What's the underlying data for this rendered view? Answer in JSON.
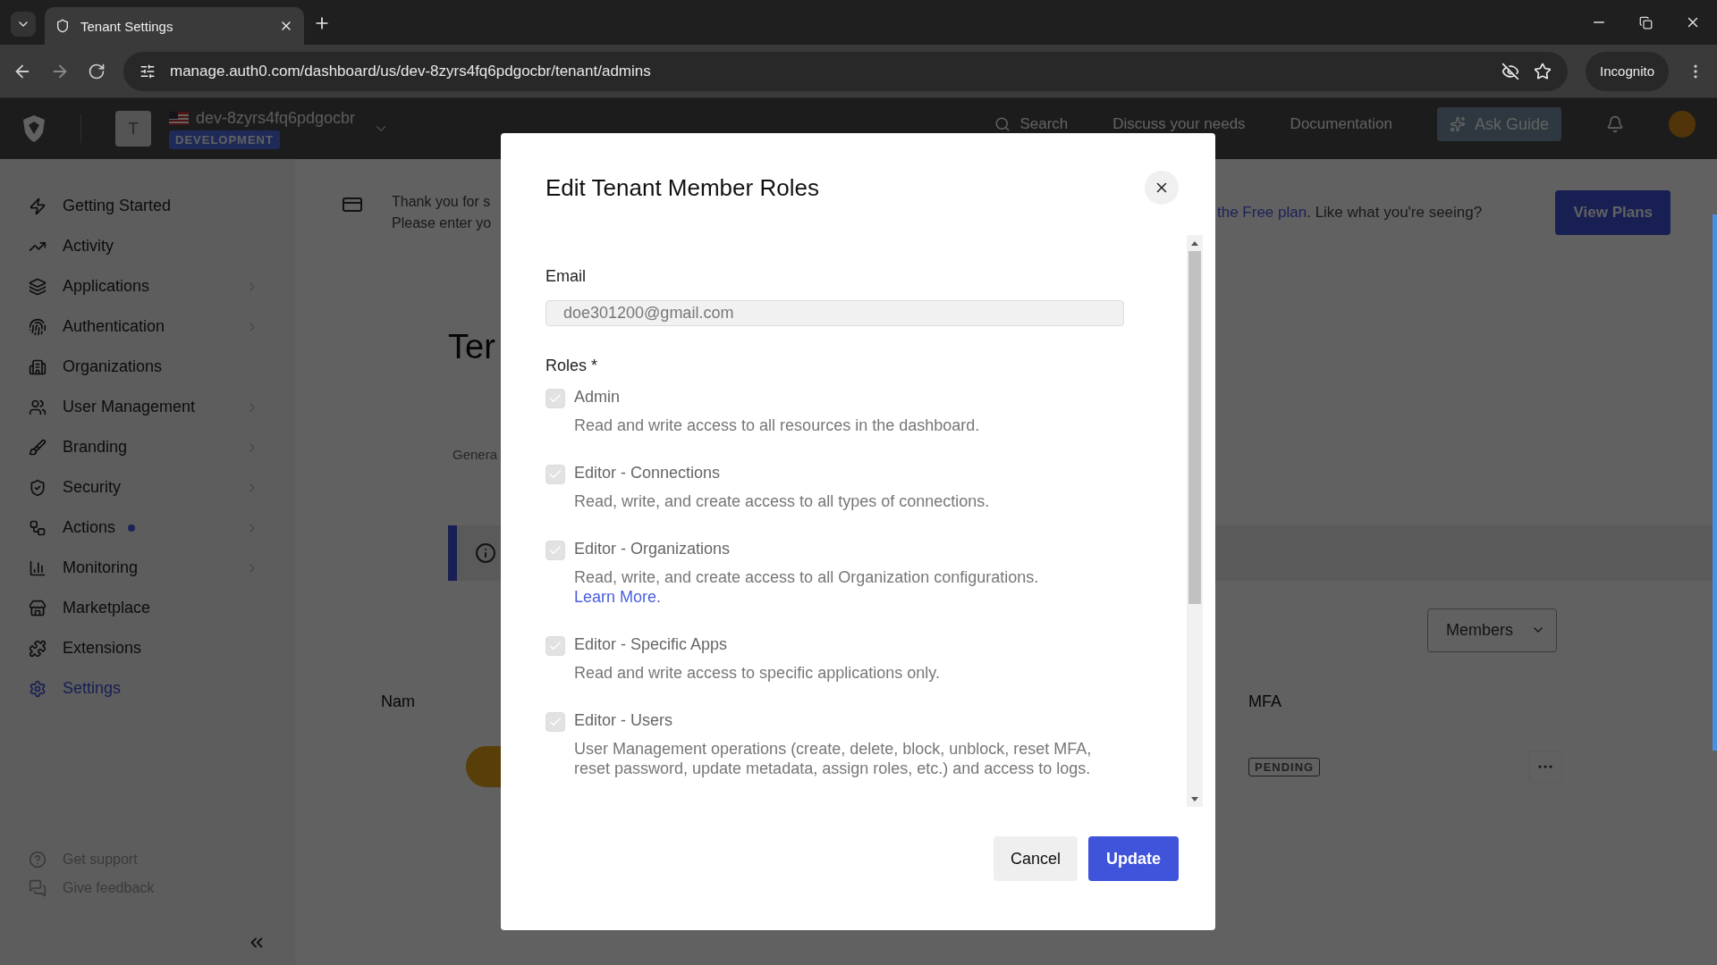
{
  "browser": {
    "tab_title": "Tenant Settings",
    "url": "manage.auth0.com/dashboard/us/dev-8zyrs4fq6pdgocbr/tenant/admins",
    "profile": "Incognito"
  },
  "header": {
    "tenant_initial": "T",
    "tenant_name": "dev-8zyrs4fq6pdgocbr",
    "environment": "DEVELOPMENT",
    "search": "Search",
    "links": [
      "Discuss your needs",
      "Documentation"
    ],
    "ask_guide": "Ask Guide"
  },
  "sidebar": {
    "items": [
      {
        "label": "Getting Started",
        "expandable": false,
        "badge": false,
        "selected": false
      },
      {
        "label": "Activity",
        "expandable": false,
        "badge": false,
        "selected": false
      },
      {
        "label": "Applications",
        "expandable": true,
        "badge": false,
        "selected": false
      },
      {
        "label": "Authentication",
        "expandable": true,
        "badge": false,
        "selected": false
      },
      {
        "label": "Organizations",
        "expandable": false,
        "badge": false,
        "selected": false
      },
      {
        "label": "User Management",
        "expandable": true,
        "badge": false,
        "selected": false
      },
      {
        "label": "Branding",
        "expandable": true,
        "badge": false,
        "selected": false
      },
      {
        "label": "Security",
        "expandable": true,
        "badge": false,
        "selected": false
      },
      {
        "label": "Actions",
        "expandable": true,
        "badge": true,
        "selected": false
      },
      {
        "label": "Monitoring",
        "expandable": true,
        "badge": false,
        "selected": false
      },
      {
        "label": "Marketplace",
        "expandable": false,
        "badge": false,
        "selected": false
      },
      {
        "label": "Extensions",
        "expandable": false,
        "badge": false,
        "selected": false
      },
      {
        "label": "Settings",
        "expandable": false,
        "badge": false,
        "selected": true
      }
    ],
    "footer": [
      "Get support",
      "Give feedback"
    ]
  },
  "page": {
    "banner_left": [
      "Thank you for s",
      "Please enter yo"
    ],
    "banner_link": "the Free plan",
    "banner_right": ". Like what you're seeing?",
    "view_plans": "View Plans",
    "heading": "Ter",
    "tab": "Genera",
    "filter": "Members",
    "columns": [
      "Nam",
      "MFA"
    ],
    "row_status": "PENDING"
  },
  "modal": {
    "title": "Edit Tenant Member Roles",
    "email_label": "Email",
    "email": "doe301200@gmail.com",
    "roles_label": "Roles *",
    "roles": [
      {
        "name": "Admin",
        "description": "Read and write access to all resources in the dashboard.",
        "checked": true,
        "disabled": true
      },
      {
        "name": "Editor - Connections",
        "description": "Read, write, and create access to all types of connections.",
        "checked": true,
        "disabled": true
      },
      {
        "name": "Editor - Organizations",
        "description": "Read, write, and create access to all Organization configurations.",
        "link": "Learn More.",
        "checked": true,
        "disabled": true
      },
      {
        "name": "Editor - Specific Apps",
        "description": "Read and write access to specific applications only.",
        "checked": true,
        "disabled": true
      },
      {
        "name": "Editor - Users",
        "description": "User Management operations (create, delete, block, unblock, reset MFA, reset password, update metadata, assign roles, etc.) and access to logs.",
        "checked": true,
        "disabled": true
      }
    ],
    "cancel": "Cancel",
    "update": "Update"
  }
}
